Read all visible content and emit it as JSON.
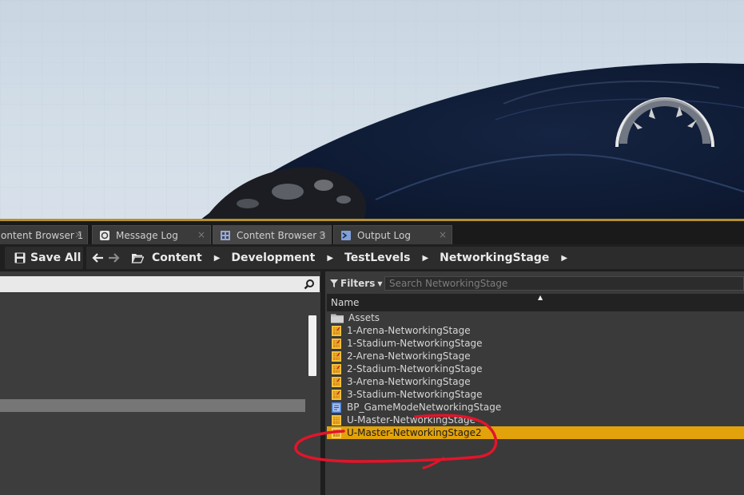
{
  "tabs": [
    {
      "label": "ontent Browser 1",
      "icon": "content-browser-icon",
      "close": "×"
    },
    {
      "label": "Message Log",
      "icon": "message-log-icon",
      "close": "×"
    },
    {
      "label": "Content Browser 3",
      "icon": "content-browser-icon",
      "close": "×",
      "active": true
    },
    {
      "label": "Output Log",
      "icon": "output-log-icon",
      "close": "×"
    }
  ],
  "toolbar": {
    "save_all": "Save All",
    "back_icon": "back-arrow-icon",
    "forward_icon": "forward-arrow-icon",
    "breadcrumbs": [
      "Content",
      "Development",
      "TestLevels",
      "NetworkingStage"
    ],
    "separator": "▶"
  },
  "left_panel": {
    "search_icon": "search-icon"
  },
  "right_panel": {
    "filters_label": "Filters",
    "search_placeholder": "Search NetworkingStage",
    "column_name": "Name",
    "sort_glyph": "▲"
  },
  "assets": [
    {
      "name": "Assets",
      "type": "folder"
    },
    {
      "name": "1-Arena-NetworkingStage",
      "type": "level"
    },
    {
      "name": "1-Stadium-NetworkingStage",
      "type": "level"
    },
    {
      "name": "2-Arena-NetworkingStage",
      "type": "level"
    },
    {
      "name": "2-Stadium-NetworkingStage",
      "type": "level"
    },
    {
      "name": "3-Arena-NetworkingStage",
      "type": "level"
    },
    {
      "name": "3-Stadium-NetworkingStage",
      "type": "level"
    },
    {
      "name": "BP_GameModeNetworkingStage",
      "type": "blueprint"
    },
    {
      "name": "U-Master-NetworkingStage",
      "type": "level"
    },
    {
      "name": "U-Master-NetworkingStage2",
      "type": "level",
      "selected": true
    }
  ],
  "colors": {
    "selection": "#e2a20b",
    "annotation": "#e3142a",
    "accent_border": "#b5902f"
  }
}
